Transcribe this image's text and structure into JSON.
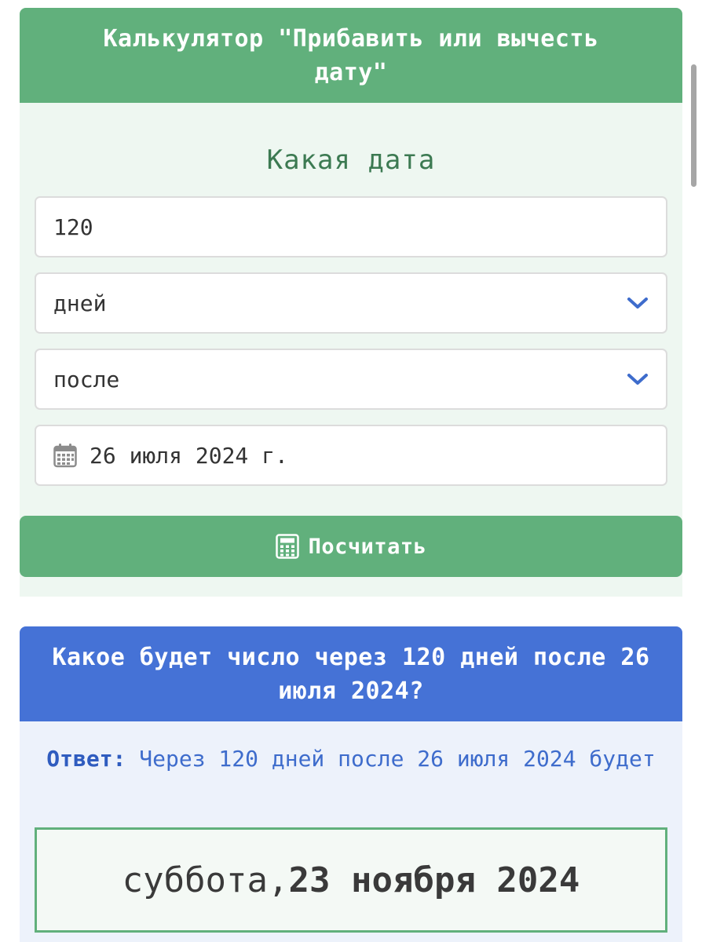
{
  "calculator": {
    "title": "Калькулятор \"Прибавить или вычесть дату\"",
    "subtitle": "Какая дата",
    "amount_value": "120",
    "unit_selected": "дней",
    "direction_selected": "после",
    "date_value": "26 июля 2024 г.",
    "submit_label": "Посчитать"
  },
  "result": {
    "title": "Какое будет число через 120 дней после 26 июля 2024?",
    "answer_label": "Ответ:",
    "answer_text": " Через 120 дней после 26 июля 2024 будет",
    "weekday": "суббота, ",
    "date": "23 ноября 2024"
  },
  "icons": {
    "select_arrow": "chevron-down-icon",
    "date_field": "calendar-icon",
    "submit": "calculator-icon"
  },
  "colors": {
    "green": "#61b07c",
    "blue": "#4572d6",
    "chevron": "#3e6ccc"
  }
}
